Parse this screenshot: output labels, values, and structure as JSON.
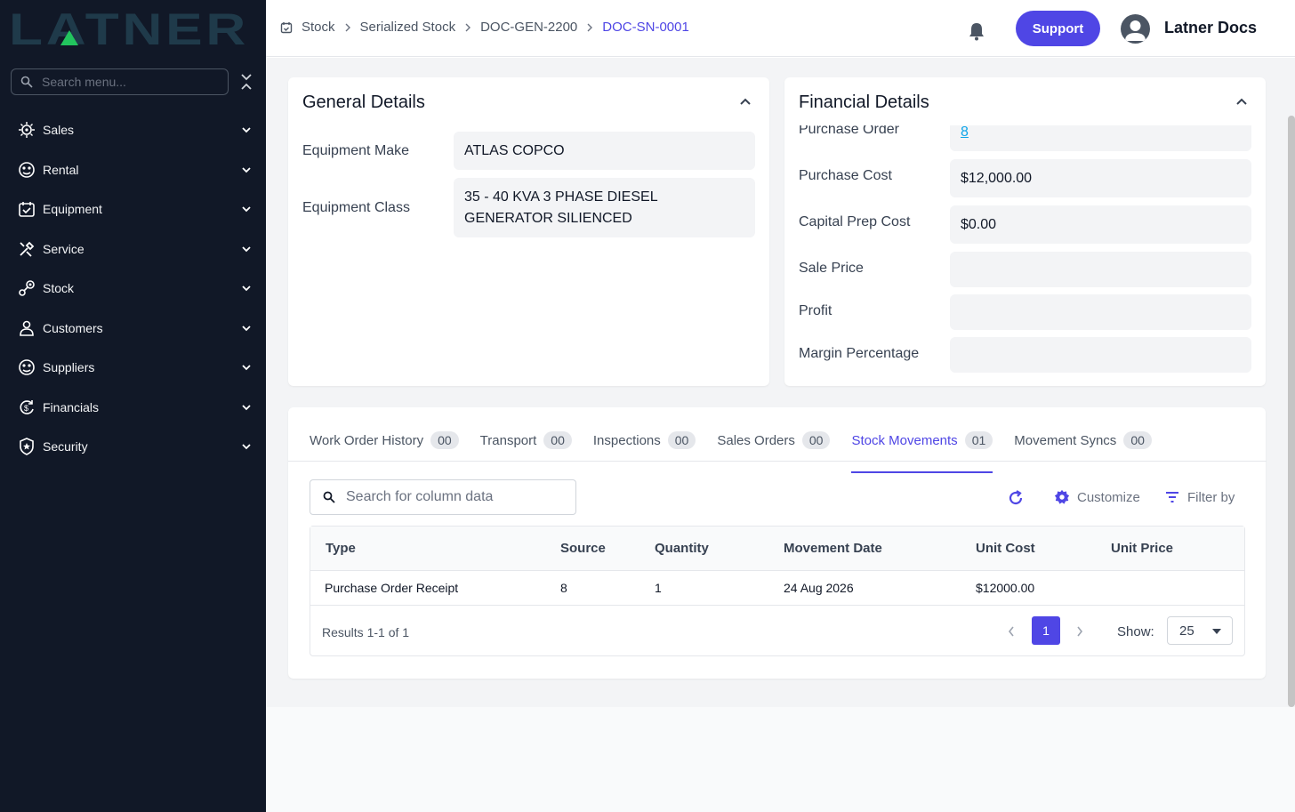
{
  "app": {
    "logo_text": "LATNER",
    "accent": "#4f46e5",
    "sidebar_bg": "#111827"
  },
  "sidebar": {
    "search_placeholder": "Search menu...",
    "items": [
      {
        "label": "Sales",
        "icon": "sales-icon"
      },
      {
        "label": "Rental",
        "icon": "rental-icon"
      },
      {
        "label": "Equipment",
        "icon": "equipment-icon"
      },
      {
        "label": "Service",
        "icon": "service-icon"
      },
      {
        "label": "Stock",
        "icon": "stock-icon"
      },
      {
        "label": "Customers",
        "icon": "customers-icon"
      },
      {
        "label": "Suppliers",
        "icon": "suppliers-icon"
      },
      {
        "label": "Financials",
        "icon": "financials-icon"
      },
      {
        "label": "Security",
        "icon": "security-icon"
      }
    ]
  },
  "header": {
    "breadcrumbs": [
      "Stock",
      "Serialized Stock",
      "DOC-GEN-2200",
      "DOC-SN-0001"
    ],
    "support_label": "Support",
    "user_name": "Latner Docs"
  },
  "general": {
    "title": "General Details",
    "fields": [
      {
        "label": "Equipment Make",
        "value": "ATLAS COPCO"
      },
      {
        "label": "Equipment Class",
        "value": "35 - 40 KVA 3 PHASE DIESEL GENERATOR SILIENCED"
      }
    ]
  },
  "financial": {
    "title": "Financial Details",
    "purchase_order_label": "Purchase Order",
    "purchase_order_value": "8",
    "fields": [
      {
        "label": "Purchase Cost",
        "value": "$12,000.00"
      },
      {
        "label": "Capital Prep Cost",
        "value": "$0.00"
      },
      {
        "label": "Sale Price",
        "value": ""
      },
      {
        "label": "Profit",
        "value": ""
      },
      {
        "label": "Margin Percentage",
        "value": ""
      }
    ]
  },
  "tabs": [
    {
      "label": "Work Order History",
      "count": "00"
    },
    {
      "label": "Transport",
      "count": "00"
    },
    {
      "label": "Inspections",
      "count": "00"
    },
    {
      "label": "Sales Orders",
      "count": "00"
    },
    {
      "label": "Stock Movements",
      "count": "01",
      "active": true
    },
    {
      "label": "Movement Syncs",
      "count": "00"
    }
  ],
  "table": {
    "search_placeholder": "Search for column data",
    "customize_label": "Customize",
    "filter_label": "Filter by",
    "columns": [
      "Type",
      "Source",
      "Quantity",
      "Movement Date",
      "Unit Cost",
      "Unit Price"
    ],
    "rows": [
      [
        "Purchase Order Receipt",
        "8",
        "1",
        "24 Aug 2026",
        "$12000.00",
        ""
      ]
    ],
    "results_text": "Results 1-1 of 1",
    "current_page": "1",
    "show_label": "Show:",
    "page_size": "25"
  }
}
